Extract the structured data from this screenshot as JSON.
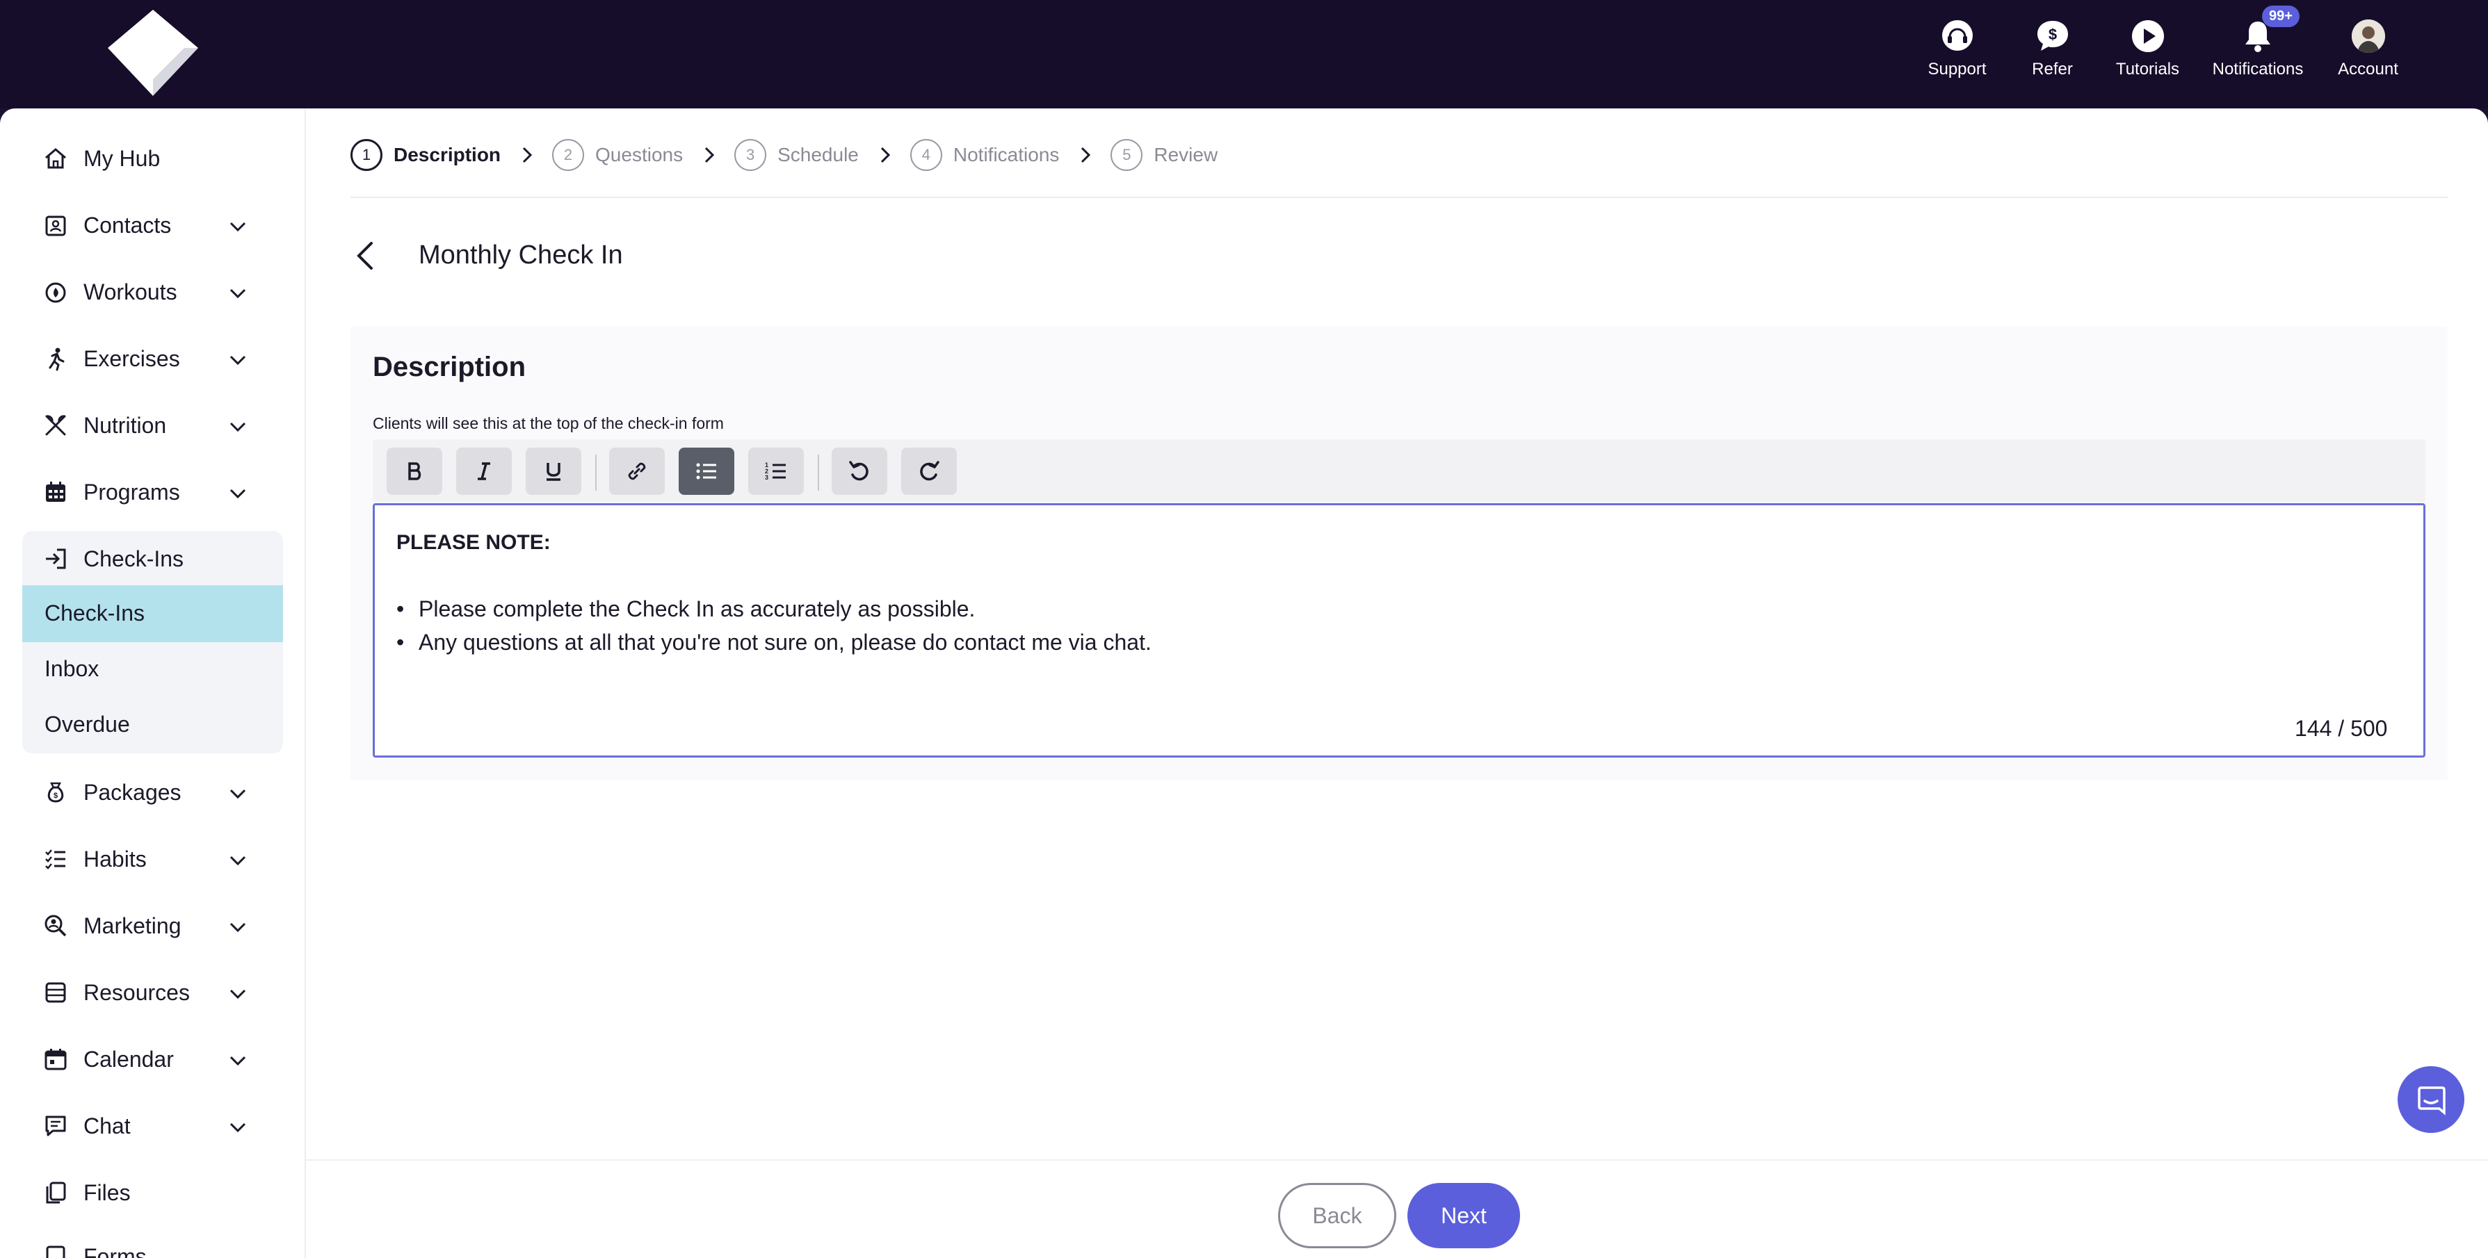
{
  "topnav": {
    "support": "Support",
    "refer": "Refer",
    "tutorials": "Tutorials",
    "notifications": "Notifications",
    "notifications_badge": "99+",
    "account": "Account"
  },
  "sidebar": {
    "my_hub": "My Hub",
    "contacts": "Contacts",
    "workouts": "Workouts",
    "exercises": "Exercises",
    "nutrition": "Nutrition",
    "programs": "Programs",
    "checkins": "Check-Ins",
    "sub_checkins": "Check-Ins",
    "sub_inbox": "Inbox",
    "sub_overdue": "Overdue",
    "packages": "Packages",
    "habits": "Habits",
    "marketing": "Marketing",
    "resources": "Resources",
    "calendar": "Calendar",
    "chat": "Chat",
    "files": "Files",
    "forms": "Forms"
  },
  "stepper": {
    "s1": {
      "num": "1",
      "label": "Description"
    },
    "s2": {
      "num": "2",
      "label": "Questions"
    },
    "s3": {
      "num": "3",
      "label": "Schedule"
    },
    "s4": {
      "num": "4",
      "label": "Notifications"
    },
    "s5": {
      "num": "5",
      "label": "Review"
    }
  },
  "page": {
    "title": "Monthly Check In"
  },
  "description": {
    "title": "Description",
    "subtitle": "Clients will see this at the top of the check-in form",
    "heading": "PLEASE NOTE:",
    "bullet_1": "Please complete the Check In as accurately as possible.",
    "bullet_2": "Any questions at all that you're not sure on, please do contact me via chat.",
    "char_count": "144 / 500"
  },
  "footer": {
    "back": "Back",
    "next": "Next"
  },
  "colors": {
    "topbar": "#160d2a",
    "accent": "#5b5fdc",
    "subnav_active": "#b4e2ec"
  }
}
